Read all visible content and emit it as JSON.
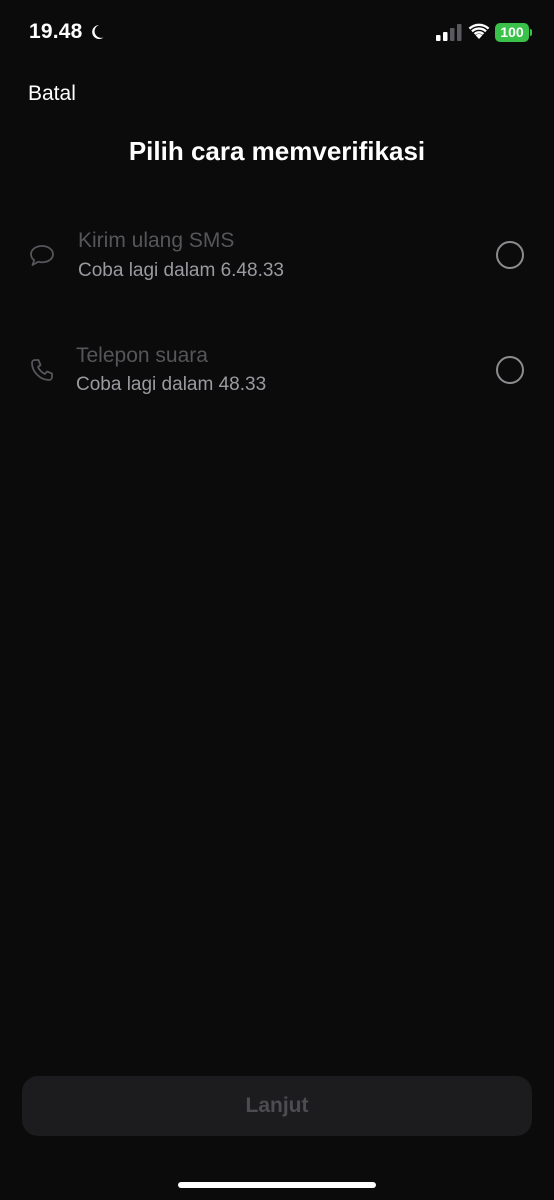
{
  "status_bar": {
    "time": "19.48",
    "battery": "100",
    "icons": [
      "moon-icon",
      "signal-icon",
      "wifi-icon",
      "battery-icon"
    ],
    "battery_color": "#3ac14a"
  },
  "header": {
    "cancel_label": "Batal",
    "title": "Pilih cara memverifikasi"
  },
  "options": [
    {
      "icon": "chat-bubble-icon",
      "title": "Kirim ulang SMS",
      "subtitle": "Coba lagi dalam 6.48.33",
      "selected": false
    },
    {
      "icon": "phone-icon",
      "title": "Telepon suara",
      "subtitle": "Coba lagi dalam 48.33",
      "selected": false
    }
  ],
  "footer": {
    "next_label": "Lanjut",
    "next_enabled": false
  }
}
